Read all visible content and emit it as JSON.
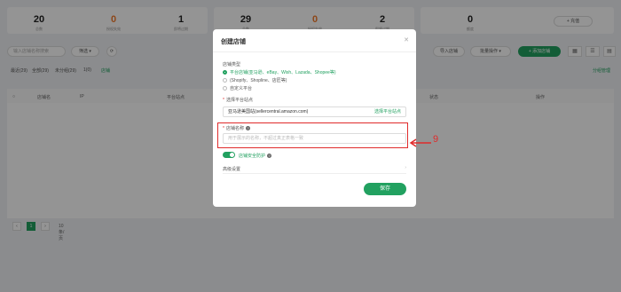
{
  "stats": [
    {
      "num": "20",
      "label": "总数",
      "orange": false
    },
    {
      "num": "0",
      "label": "授权失效",
      "orange": true
    },
    {
      "num": "1",
      "label": "即将过期",
      "orange": false
    },
    {
      "num": "29",
      "label": "总数",
      "orange": false
    },
    {
      "num": "0",
      "label": "授权失效",
      "orange": true
    },
    {
      "num": "2",
      "label": "即将过期",
      "orange": false
    },
    {
      "num": "0",
      "label": "额度",
      "orange": false
    }
  ],
  "recharge_label": "+ 充值",
  "toolbar": {
    "search_placeholder": "输入店铺名称搜索",
    "filter_label": "筛选 ▾",
    "import_label": "导入店铺",
    "batch_label": "批量操作 ▾",
    "add_label": "+ 添加店铺"
  },
  "tabs": [
    "最近(29)",
    "全部(29)",
    "未分组(29)",
    "1(0)",
    "店铺"
  ],
  "group_manage": "分组管理",
  "table_headers": [
    "店铺名",
    "IP",
    "平台站点",
    "状态",
    "操作"
  ],
  "pager": {
    "page": "1",
    "per_page": "10条/页"
  },
  "modal": {
    "title": "创建店铺",
    "type_label": "店铺类型",
    "options": [
      "平台店铺(亚马逊、eBay、Wish、Lazada、Shopee等)",
      "(Shopify、Shopline、店匠等)",
      "自定义平台"
    ],
    "platform_label": "选择平台站点",
    "platform_value": "亚马逊美国站(sellercentral.amazon.com)",
    "platform_change": "选择平台站点",
    "name_label": "店铺名称",
    "name_placeholder": "用于展示的名称，不超过真正表格一致",
    "protect_label": "店铺安全防护",
    "advanced_label": "高级设置",
    "save_label": "保存"
  },
  "annotation": "9"
}
